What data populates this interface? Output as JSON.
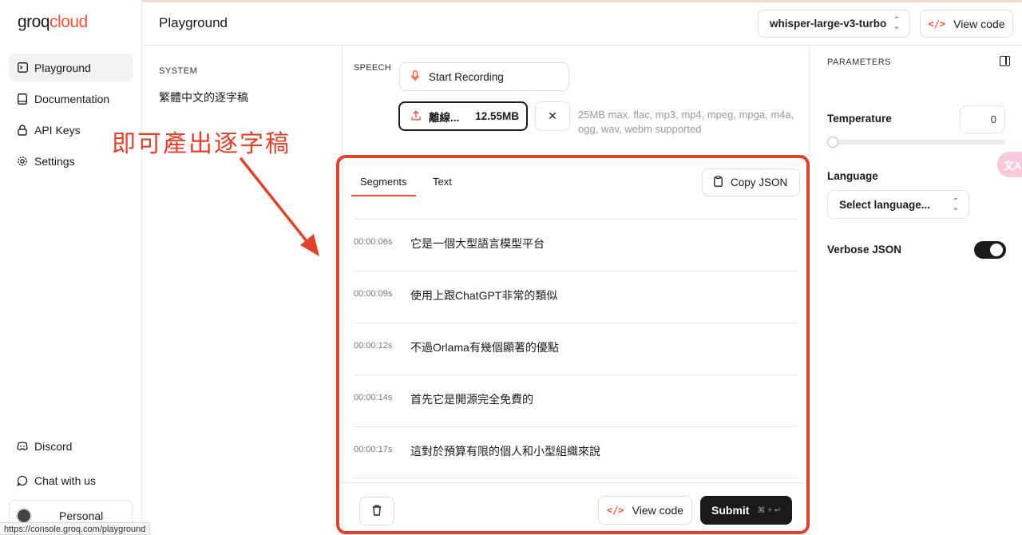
{
  "sidebar": {
    "logo_main": "groq",
    "logo_suffix": "cloud",
    "items": [
      {
        "label": "Playground",
        "icon": "playground-icon"
      },
      {
        "label": "Documentation",
        "icon": "book-icon"
      },
      {
        "label": "API Keys",
        "icon": "key-icon"
      },
      {
        "label": "Settings",
        "icon": "gear-icon"
      }
    ],
    "bottom_items": [
      {
        "label": "Discord",
        "icon": "discord-icon"
      },
      {
        "label": "Chat with us",
        "icon": "chat-icon"
      }
    ],
    "account_label": "Personal"
  },
  "status_url": "https://console.groq.com/playground",
  "header": {
    "title": "Playground",
    "model": "whisper-large-v3-turbo",
    "view_code_label": "View code"
  },
  "system": {
    "label": "SYSTEM",
    "text": "繁體中文的逐字稿"
  },
  "speech": {
    "label": "SPEECH",
    "record_label": "Start Recording",
    "file_name": "離線...",
    "file_size": "12.55MB",
    "help_text": "25MB max. flac, mp3, mp4, mpeg, mpga, m4a, ogg, wav, webm supported"
  },
  "results": {
    "tabs": [
      "Segments",
      "Text"
    ],
    "active_tab": "Segments",
    "copy_label": "Copy JSON",
    "segments": [
      {
        "time": "00:00:06s",
        "text": "它是一個大型語言模型平台"
      },
      {
        "time": "00:00:09s",
        "text": "使用上跟ChatGPT非常的類似"
      },
      {
        "time": "00:00:12s",
        "text": "不過Orlama有幾個顯著的優點"
      },
      {
        "time": "00:00:14s",
        "text": "首先它是開源完全免費的"
      },
      {
        "time": "00:00:17s",
        "text": "這對於預算有限的個人和小型組織來說"
      }
    ],
    "view_code_label": "View code",
    "submit_label": "Submit",
    "submit_shortcut": "⌘ + ↵"
  },
  "annotation": {
    "text": "即可產出逐字稿",
    "color": "#e0412c"
  },
  "parameters": {
    "label": "PARAMETERS",
    "temperature_label": "Temperature",
    "temperature_value": "0",
    "temperature_level": 0,
    "language_label": "Language",
    "language_placeholder": "Select language...",
    "verbose_label": "Verbose JSON",
    "verbose_on": true
  },
  "translate_badge": "文A",
  "colors": {
    "accent": "#f55036",
    "dark": "#1a1a1a"
  }
}
